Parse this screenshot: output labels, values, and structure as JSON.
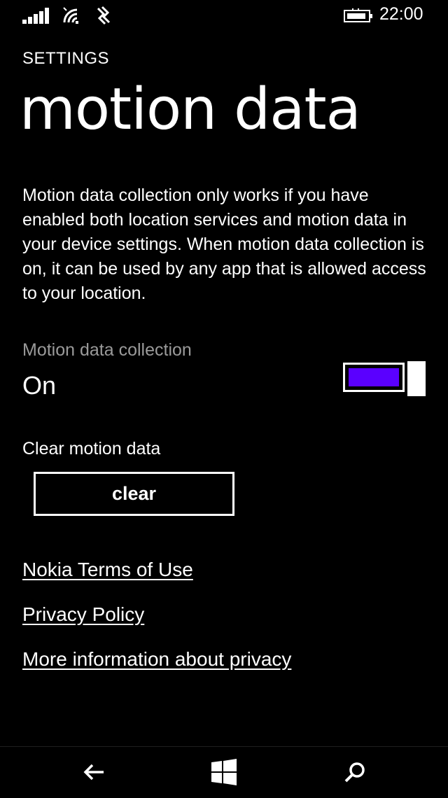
{
  "status_bar": {
    "time": "22:00",
    "icons": [
      "signal-icon",
      "wifi-icon",
      "sync-icon",
      "battery-charging-icon"
    ]
  },
  "header": {
    "section": "SETTINGS",
    "title": "motion data"
  },
  "description": "Motion data collection only works if you have enabled both location services and motion data in your device settings. When motion data collection is on, it can be used by any app that is allowed access to your location.",
  "motion_setting": {
    "label": "Motion data collection",
    "value": "On",
    "enabled": true,
    "accent_color": "#5a00ff"
  },
  "clear_section": {
    "label": "Clear motion data",
    "button_label": "clear"
  },
  "links": {
    "terms": "Nokia Terms of Use",
    "privacy": "Privacy Policy",
    "more": "More information about privacy"
  },
  "nav_bar": {
    "icons": [
      "back-arrow-icon",
      "windows-start-icon",
      "search-icon"
    ]
  }
}
